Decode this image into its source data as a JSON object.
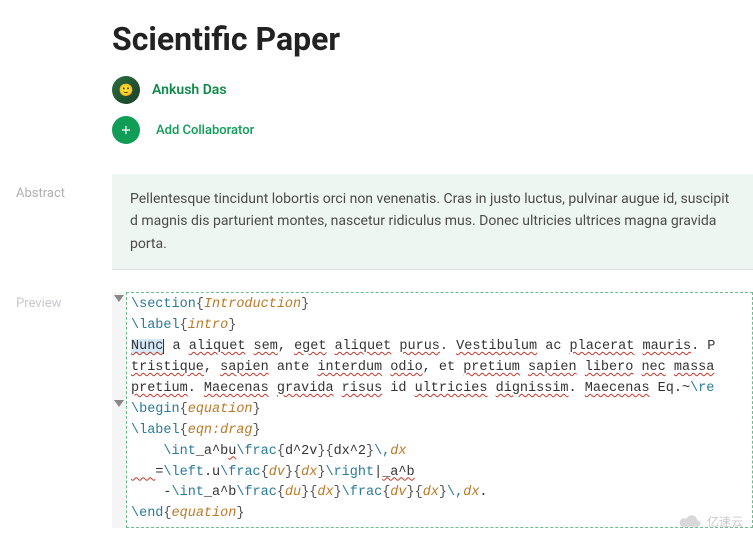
{
  "header": {
    "title": "Scientific Paper",
    "author": "Ankush Das",
    "add_collab": "Add Collaborator"
  },
  "sidebar": {
    "abstract_label": "Abstract",
    "preview_label": "Preview"
  },
  "abstract": {
    "text": "Pellentesque tincidunt lobortis orci non venenatis. Cras in justo luctus, pulvinar augue id, suscipit d magnis dis parturient montes, nascetur ridiculus mus. Donec ultricies ultrices magna gravida porta."
  },
  "code": {
    "l1_cmd": "\\section",
    "l1_arg": "Introduction",
    "l2_cmd": "\\label",
    "l2_arg": "intro",
    "l3_hl": "Nunc",
    "l3_a": " a ",
    "l3_b": "aliquet",
    "l3_c": " ",
    "l3_d": "sem",
    "l3_e": ", ",
    "l3_f": "eget",
    "l3_g": " ",
    "l3_h": "aliquet",
    "l3_i": " ",
    "l3_j": "purus",
    "l3_k": ". ",
    "l3_l": "Vestibulum",
    "l3_m": " ac ",
    "l3_n": "placerat",
    "l3_o": " ",
    "l3_p": "mauris",
    "l3_q": ". P",
    "l4_a": "tristique",
    "l4_b": ", ",
    "l4_c": "sapien",
    "l4_d": " ante ",
    "l4_e": "interdum",
    "l4_f": " ",
    "l4_g": "odio",
    "l4_h": ", et ",
    "l4_i": "pretium",
    "l4_j": " ",
    "l4_k": "sapien",
    "l4_l": " ",
    "l4_m": "libero",
    "l4_n": " ",
    "l4_o": "nec",
    "l4_p": " ",
    "l4_q": "massa",
    "l5_a": "pretium",
    "l5_b": ". ",
    "l5_c": "Maecenas",
    "l5_d": " ",
    "l5_e": "gravida",
    "l5_f": " ",
    "l5_g": "risus",
    "l5_h": " id ",
    "l5_i": "ultricies",
    "l5_j": " ",
    "l5_k": "dignissim",
    "l5_l": ". ",
    "l5_m": "Maecenas",
    "l5_n": " Eq.~",
    "l5_o": "\\re",
    "l6_cmd": "\\begin",
    "l6_arg": "equation",
    "l7_cmd": "\\label",
    "l7_arg": "eqn:drag",
    "l8_a": "    ",
    "l8_b": "\\int",
    "l8_c": "_a^b",
    "l8_d": "u",
    "l8_e": "\\frac",
    "l8_f": "d^2v",
    "l8_g": "dx^2",
    "l8_h": "\\,",
    "l8_i": "dx",
    "l9_a": "   ",
    "l9_b": "=",
    "l9_c": "\\left",
    "l9_d": ".u",
    "l9_e": "\\frac",
    "l9_f": "dv",
    "l9_g": "dx",
    "l9_h": "\\right",
    "l9_i": "|",
    "l9_j": "_a^b",
    "l10_a": "    -",
    "l10_b": "\\int",
    "l10_c": "_a^b",
    "l10_d": "\\frac",
    "l10_e": "du",
    "l10_f": "dx",
    "l10_g": "\\frac",
    "l10_h": "dv",
    "l10_i": "dx",
    "l10_j": "\\,",
    "l10_k": "dx",
    "l10_l": ".",
    "l11_cmd": "\\end",
    "l11_arg": "equation"
  },
  "watermark": "亿速云"
}
